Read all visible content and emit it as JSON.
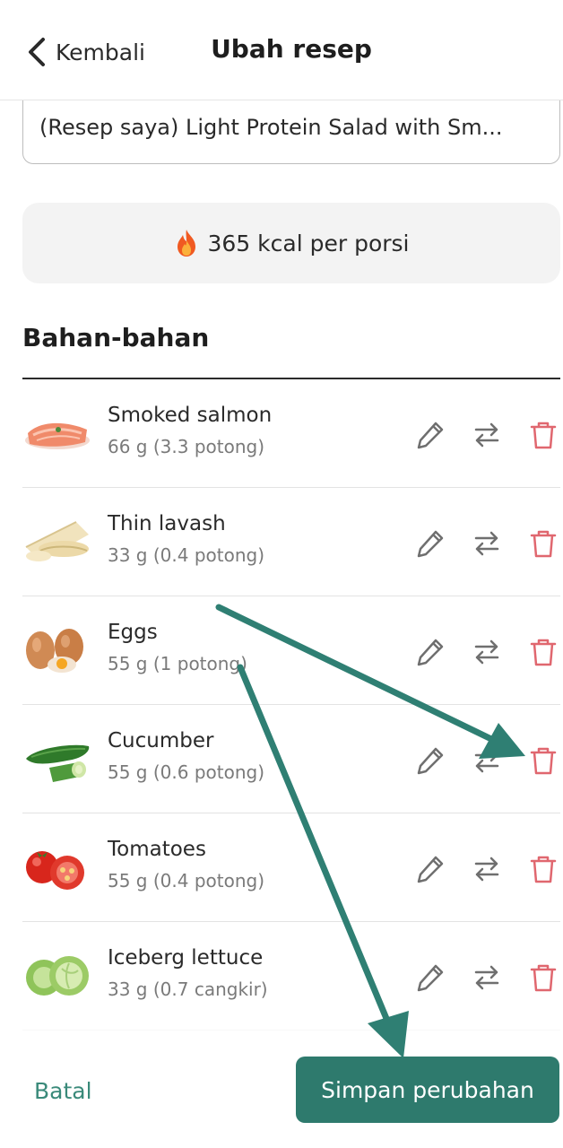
{
  "header": {
    "back_label": "Kembali",
    "title": "Ubah resep"
  },
  "recipe": {
    "name": "(Resep saya) Light Protein Salad with Sm..."
  },
  "calories": {
    "icon": "fire-icon",
    "text": "365 kcal per porsi"
  },
  "ingredients_section": {
    "title": "Bahan-bahan"
  },
  "ingredients": [
    {
      "name": "Smoked salmon",
      "qty": "66 g (3.3 potong)",
      "image": "smoked-salmon-image"
    },
    {
      "name": "Thin lavash",
      "qty": "33 g (0.4 potong)",
      "image": "lavash-image"
    },
    {
      "name": "Eggs",
      "qty": "55 g (1 potong)",
      "image": "eggs-image"
    },
    {
      "name": "Cucumber",
      "qty": "55 g (0.6 potong)",
      "image": "cucumber-image"
    },
    {
      "name": "Tomatoes",
      "qty": "55 g (0.4 potong)",
      "image": "tomatoes-image"
    },
    {
      "name": "Iceberg lettuce",
      "qty": "33 g (0.7 cangkir)",
      "image": "lettuce-image"
    }
  ],
  "row_actions": [
    "pencil-icon",
    "swap-icon",
    "trash-icon"
  ],
  "footer": {
    "cancel_label": "Batal",
    "save_label": "Simpan perubahan"
  },
  "colors": {
    "accent": "#2e7a6d",
    "cancel_text": "#3a8a7a",
    "delete_icon": "#e0676f",
    "annotation_arrow": "#2f7f73"
  }
}
